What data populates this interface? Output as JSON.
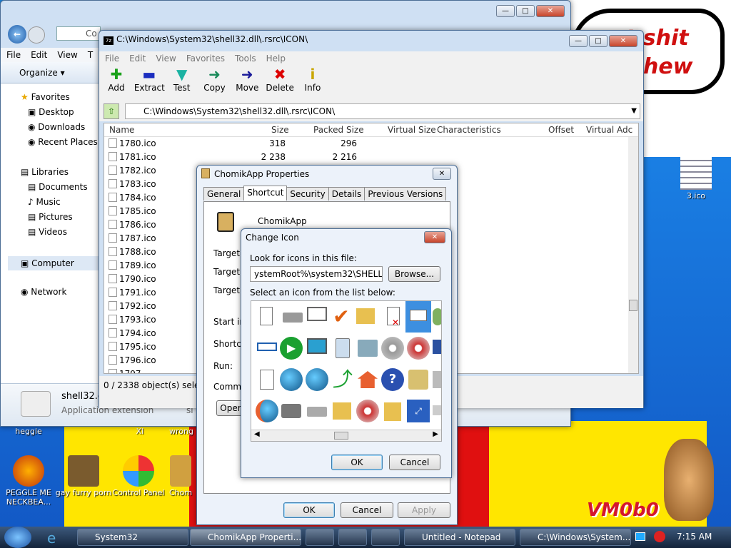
{
  "desktop": {
    "bubble_line1": "t shit",
    "bubble_line2": "hew",
    "icons": [
      {
        "label": "heggle"
      },
      {
        "label": "XI"
      },
      {
        "label": "wrong"
      },
      {
        "label": "PEGGLE ME NECKBEA..."
      },
      {
        "label": "gay furry porn"
      },
      {
        "label": "Control Panel"
      },
      {
        "label": "Chom"
      },
      {
        "label": "3.ico"
      }
    ],
    "watermark": "VM0b0"
  },
  "explorer": {
    "address_partial": "Co",
    "menu": [
      "File",
      "Edit",
      "View",
      "T"
    ],
    "organize": "Organize",
    "favorites_header": "Favorites",
    "favorites": [
      "Desktop",
      "Downloads",
      "Recent Places"
    ],
    "libraries_header": "Libraries",
    "libraries": [
      "Documents",
      "Music",
      "Pictures",
      "Videos"
    ],
    "computer": "Computer",
    "network": "Network",
    "file_name": "shell32.d",
    "file_type": "Application extension",
    "file_extra": "si"
  },
  "zip": {
    "title": "C:\\Windows\\System32\\shell32.dll\\.rsrc\\ICON\\",
    "menu": [
      "File",
      "Edit",
      "View",
      "Favorites",
      "Tools",
      "Help"
    ],
    "toolbar": [
      "Add",
      "Extract",
      "Test",
      "Copy",
      "Move",
      "Delete",
      "Info"
    ],
    "path": "C:\\Windows\\System32\\shell32.dll\\.rsrc\\ICON\\",
    "columns": [
      "Name",
      "Size",
      "Packed Size",
      "Virtual Size",
      "Characteristics",
      "Offset",
      "Virtual Adc"
    ],
    "rows": [
      {
        "name": "1780.ico",
        "size": "318",
        "packed": "296"
      },
      {
        "name": "1781.ico",
        "size": "2 238",
        "packed": "2 216"
      },
      {
        "name": "1782.ico"
      },
      {
        "name": "1783.ico"
      },
      {
        "name": "1784.ico"
      },
      {
        "name": "1785.ico"
      },
      {
        "name": "1786.ico"
      },
      {
        "name": "1787.ico"
      },
      {
        "name": "1788.ico"
      },
      {
        "name": "1789.ico"
      },
      {
        "name": "1790.ico"
      },
      {
        "name": "1791.ico"
      },
      {
        "name": "1792.ico"
      },
      {
        "name": "1793.ico"
      },
      {
        "name": "1794.ico"
      },
      {
        "name": "1795.ico"
      },
      {
        "name": "1796.ico"
      },
      {
        "name": "1797"
      }
    ],
    "status": "0 / 2338 object(s) selecte"
  },
  "props": {
    "title": "ChomikApp Properties",
    "tabs": [
      "General",
      "Shortcut",
      "Security",
      "Details",
      "Previous Versions"
    ],
    "app_name": "ChomikApp",
    "labels": [
      "Target ty",
      "Target lo",
      "Target:",
      "Start in:",
      "Shortcut",
      "Run:",
      "Commen"
    ],
    "open_btn": "Oper",
    "ok": "OK",
    "cancel": "Cancel",
    "apply": "Apply"
  },
  "change_icon": {
    "title": "Change Icon",
    "look_label": "Look for icons in this file:",
    "file_path": "ystemRoot%\\system32\\SHELL32.dll",
    "browse": "Browse...",
    "select_label": "Select an icon from the list below:",
    "ok": "OK",
    "cancel": "Cancel"
  },
  "taskbar": {
    "items": [
      "System32",
      "ChomikApp Properti...",
      "",
      "",
      "",
      "Untitled - Notepad",
      "C:\\Windows\\System..."
    ],
    "clock": "7:15 AM"
  }
}
